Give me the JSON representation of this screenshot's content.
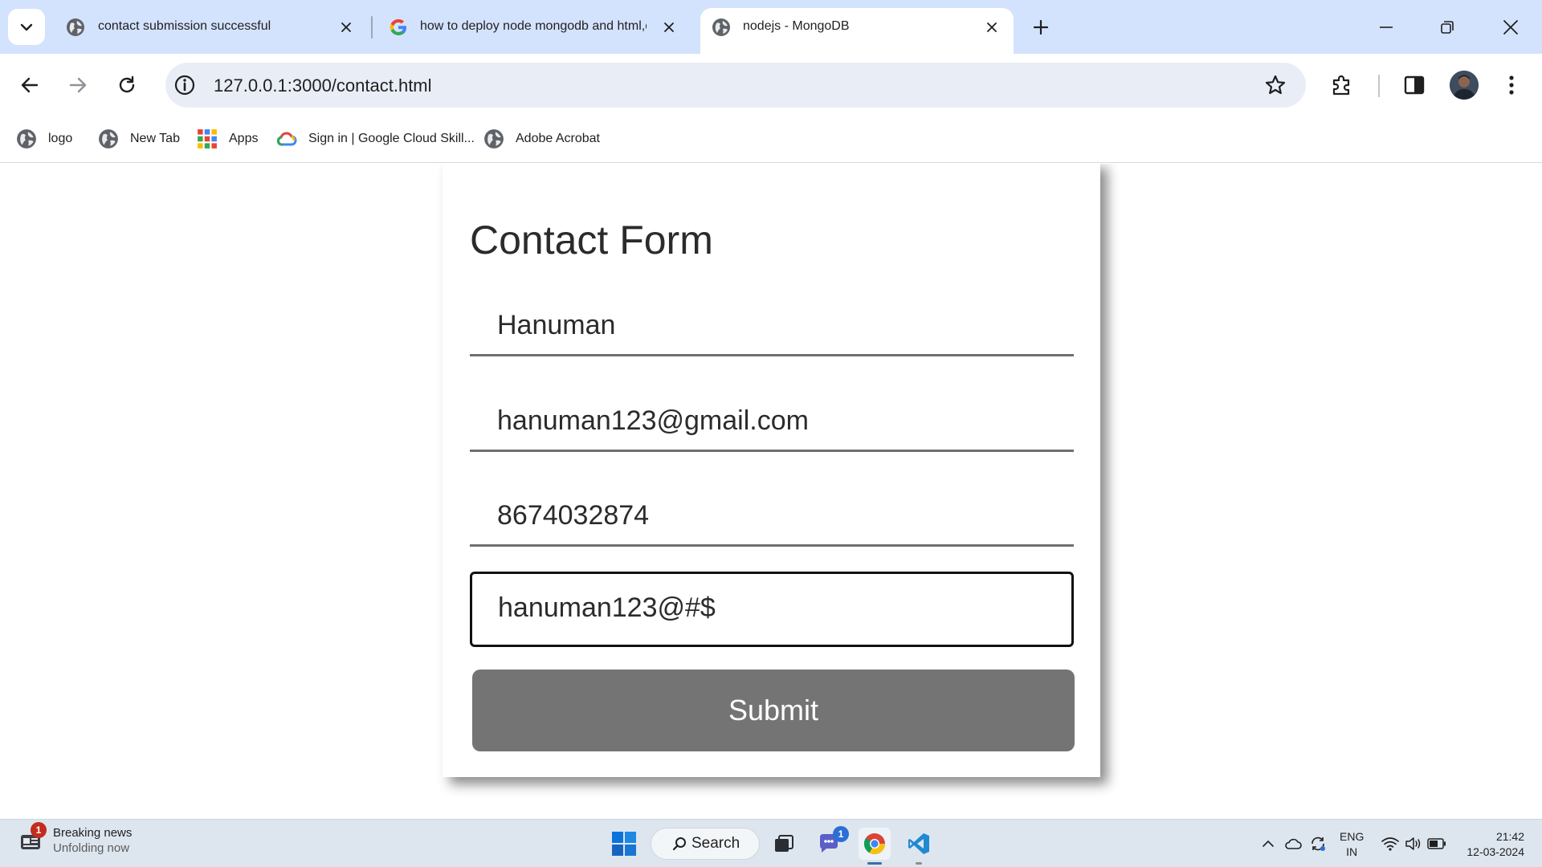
{
  "colors": {
    "tabstrip_bg": "#d3e3fd",
    "omnibox_bg": "#e9eef6",
    "submit_bg": "#757475",
    "taskbar_bg": "#dde6ef"
  },
  "tabs": [
    {
      "title": "contact submission successful",
      "icon": "globe-icon",
      "active": false
    },
    {
      "title": "how to deploy node mongodb and html,c",
      "icon": "google-icon",
      "active": false
    },
    {
      "title": "nodejs - MongoDB",
      "icon": "globe-icon",
      "active": true
    }
  ],
  "toolbar": {
    "url": "127.0.0.1:3000/contact.html"
  },
  "bookmarks": [
    {
      "label": "logo",
      "icon": "globe-icon"
    },
    {
      "label": "New Tab",
      "icon": "globe-icon"
    },
    {
      "label": "Apps",
      "icon": "apps-grid-icon"
    },
    {
      "label": "Sign in | Google Cloud Skill...",
      "icon": "google-cloud-icon"
    },
    {
      "label": "Adobe Acrobat",
      "icon": "globe-icon"
    }
  ],
  "form": {
    "title": "Contact Form",
    "name_value": "Hanuman",
    "email_value": "hanuman123@gmail.com",
    "phone_value": "8674032874",
    "password_value": "hanuman123@#$",
    "submit_label": "Submit"
  },
  "taskbar": {
    "news_badge": "1",
    "news_title": "Breaking news",
    "news_subtitle": "Unfolding now",
    "search_label": "Search",
    "teams_badge": "1",
    "lang_line1": "ENG",
    "lang_line2": "IN",
    "time": "21:42",
    "date": "12-03-2024"
  }
}
